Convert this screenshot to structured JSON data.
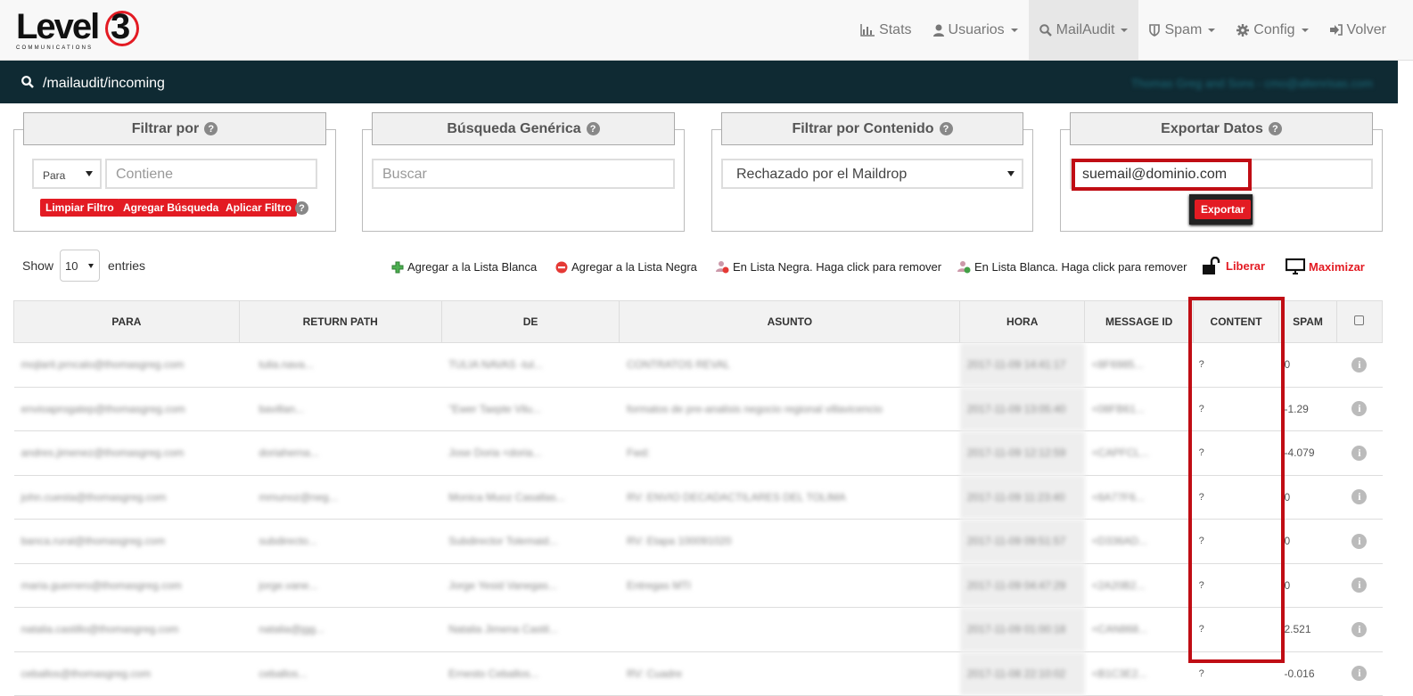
{
  "brand": {
    "name": "Level",
    "mark": "3",
    "sub": "COMMUNICATIONS"
  },
  "nav": [
    {
      "icon": "bar-chart-icon",
      "label": "Stats"
    },
    {
      "icon": "user-icon",
      "label": "Usuarios",
      "caret": true
    },
    {
      "icon": "search-icon",
      "label": "MailAudit",
      "caret": true,
      "active": true
    },
    {
      "icon": "shield-icon",
      "label": "Spam",
      "caret": true
    },
    {
      "icon": "gear-icon",
      "label": "Config",
      "caret": true
    },
    {
      "icon": "sign-out-icon",
      "label": "Volver"
    }
  ],
  "breadcrumb": {
    "path": "/mailaudit/incoming",
    "user": "Thomas Greg and Sons - cmo@altenrisas.com"
  },
  "filter": {
    "title": "Filtrar por",
    "select_value": "Para",
    "placeholder": "Contiene",
    "btn_clear": "Limpiar Filtro",
    "btn_add": "Agregar Búsqueda",
    "btn_apply": "Aplicar Filtro"
  },
  "generic": {
    "title": "Búsqueda Genérica",
    "placeholder": "Buscar"
  },
  "content_filter": {
    "title": "Filtrar por Contenido",
    "value": "Rechazado por el Maildrop"
  },
  "export": {
    "title": "Exportar Datos",
    "value": "suemail@dominio.com",
    "btn": "Exportar"
  },
  "length": {
    "show": "Show",
    "value": "10",
    "entries": "entries"
  },
  "legend": {
    "whitelist_add": "Agregar a la Lista Blanca",
    "blacklist_add": "Agregar a la Lista Negra",
    "in_blacklist": "En Lista Negra. Haga click para remover",
    "in_whitelist": "En Lista Blanca. Haga click para remover",
    "release": "Liberar",
    "maximize": "Maximizar"
  },
  "table": {
    "headers": [
      "PARA",
      "RETURN PATH",
      "DE",
      "ASUNTO",
      "HORA",
      "MESSAGE ID",
      "CONTENT",
      "SPAM"
    ],
    "rows": [
      {
        "para": "mojlarit.prncalo@thomasgreg.com",
        "rp": "tulia.nava...",
        "de": "TULIA NAVAS -tul...",
        "asunto": "CONTRATOS REVAL",
        "hora": "2017-11-09 14:41:17",
        "mid": "<8F6985...",
        "content": "?",
        "spam": "0"
      },
      {
        "para": "envioaprogatep@thomasgreg.com",
        "rp": "bavillan...",
        "de": "\"Ewer Taepte Vilu...",
        "asunto": "formatos de pre-analisis negocio regional villavicencio",
        "hora": "2017-11-09 13:05:40",
        "mid": "<08FB61...",
        "content": "?",
        "spam": "-1.29"
      },
      {
        "para": "andres.jimenez@thomasgreg.com",
        "rp": "doriaherna...",
        "de": "Jose Doria <doria...",
        "asunto": "Fwd:",
        "hora": "2017-11-09 12:12:59",
        "mid": "<CAPFCL...",
        "content": "?",
        "spam": "-4.079"
      },
      {
        "para": "john.cuesta@thomasgreg.com",
        "rp": "mmunoz@neg...",
        "de": "Monica Muoz Casallas...",
        "asunto": "RV: ENVIO DECADACTILARES DEL TOLIMA",
        "hora": "2017-11-09 11:23:40",
        "mid": "<6A77F6...",
        "content": "?",
        "spam": "0"
      },
      {
        "para": "banca.rural@thomasgreg.com",
        "rp": "subdirecto...",
        "de": "Subdirector Tolemaid...",
        "asunto": "RV: Etapa 100091020",
        "hora": "2017-11-09 09:51:57",
        "mid": "<D336AD...",
        "content": "?",
        "spam": "0"
      },
      {
        "para": "maria.guerrero@thomasgreg.com",
        "rp": "jorge.vane...",
        "de": "Jorge Yesid Vanegas...",
        "asunto": "Entregas MTI",
        "hora": "2017-11-09 04:47:29",
        "mid": "<2A20B2...",
        "content": "?",
        "spam": "0"
      },
      {
        "para": "natalia.castillo@thomasgreg.com",
        "rp": "natalia@jgg...",
        "de": "Natalia Jimena Castil...",
        "asunto": "",
        "hora": "2017-11-09 01:00:18",
        "mid": "<CAN868...",
        "content": "?",
        "spam": "2.521"
      },
      {
        "para": "ceballos@thomasgreg.com",
        "rp": "ceballos...",
        "de": "Ernesto Ceballos...",
        "asunto": "RV: Cuadre",
        "hora": "2017-11-08 22:10:02",
        "mid": "<B1C3E2...",
        "content": "?",
        "spam": "-0.016"
      }
    ]
  },
  "colors": {
    "accent": "#e31b23",
    "dark": "#0f2a33",
    "highlight": "#c00d14"
  }
}
